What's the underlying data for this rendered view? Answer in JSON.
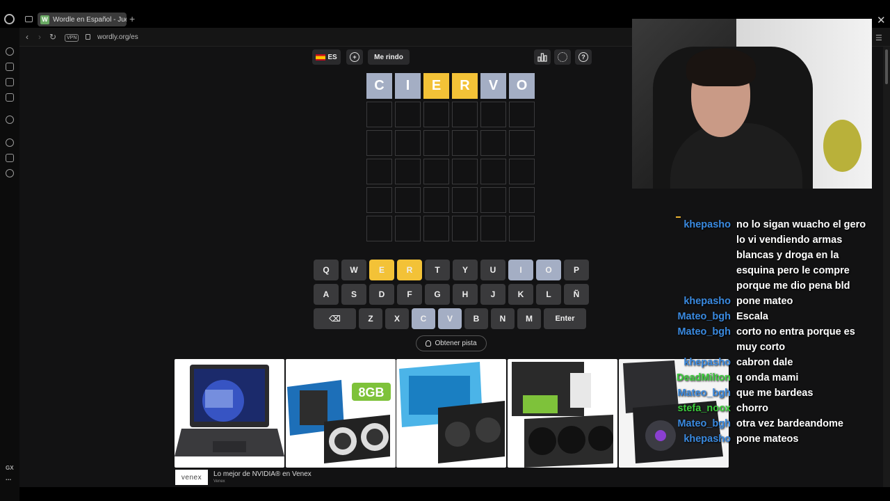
{
  "browser": {
    "tab_title": "Wordle en Español - Juego",
    "tab_favicon": "W",
    "url": "wordly.org/es",
    "vpn_label": "VPN",
    "sidebar_bottom_label": "GX"
  },
  "header": {
    "language": "ES",
    "give_up": "Me rindo",
    "icons": [
      "plus-circle-icon",
      "stats-icon",
      "settings-icon",
      "help-icon"
    ]
  },
  "board": {
    "rows": [
      [
        {
          "letter": "C",
          "state": "gray"
        },
        {
          "letter": "I",
          "state": "gray"
        },
        {
          "letter": "E",
          "state": "yellow"
        },
        {
          "letter": "R",
          "state": "yellow"
        },
        {
          "letter": "V",
          "state": "gray"
        },
        {
          "letter": "O",
          "state": "gray"
        }
      ],
      [
        {},
        {},
        {},
        {},
        {},
        {}
      ],
      [
        {},
        {},
        {},
        {},
        {},
        {}
      ],
      [
        {},
        {},
        {},
        {},
        {},
        {}
      ],
      [
        {},
        {},
        {},
        {},
        {},
        {}
      ],
      [
        {},
        {},
        {},
        {},
        {},
        {}
      ]
    ]
  },
  "keyboard": {
    "rows": [
      [
        {
          "k": "Q"
        },
        {
          "k": "W"
        },
        {
          "k": "E",
          "state": "yellow"
        },
        {
          "k": "R",
          "state": "yellow"
        },
        {
          "k": "T"
        },
        {
          "k": "Y"
        },
        {
          "k": "U"
        },
        {
          "k": "I",
          "state": "gray"
        },
        {
          "k": "O",
          "state": "gray"
        },
        {
          "k": "P"
        }
      ],
      [
        {
          "k": "A"
        },
        {
          "k": "S"
        },
        {
          "k": "D"
        },
        {
          "k": "F"
        },
        {
          "k": "G"
        },
        {
          "k": "H"
        },
        {
          "k": "J"
        },
        {
          "k": "K"
        },
        {
          "k": "L"
        },
        {
          "k": "Ñ"
        }
      ],
      [
        {
          "k": "⌫",
          "type": "backspace"
        },
        {
          "k": "Z"
        },
        {
          "k": "X"
        },
        {
          "k": "C",
          "state": "gray"
        },
        {
          "k": "V",
          "state": "gray"
        },
        {
          "k": "B"
        },
        {
          "k": "N"
        },
        {
          "k": "M"
        },
        {
          "k": "Enter",
          "type": "enter"
        }
      ]
    ]
  },
  "hint_button": "Obtener pista",
  "ad": {
    "products": [
      "laptop",
      "galax-rtx-5060ti-8gb",
      "gigabyte-rtx-5070",
      "asus-prime-rtx-5060ti",
      "gpu-dark"
    ],
    "card_texts": {
      "galax_badge": "8GB"
    },
    "brand": "venex",
    "title": "Lo mejor de NVIDIA® en Venex",
    "subtitle": "Venex"
  },
  "chat": [
    {
      "user": "khepasho",
      "color": "#3a8ae0",
      "text": "no lo sigan wuacho el gero lo vi vendiendo armas blancas y droga en la esquina pero le compre porque me dio pena bld"
    },
    {
      "user": "khepasho",
      "color": "#3a8ae0",
      "text": "pone mateo"
    },
    {
      "user": "Mateo_bgh",
      "color": "#3a8ae0",
      "text": "Escala"
    },
    {
      "user": "Mateo_bgh",
      "color": "#3a8ae0",
      "text": "corto no entra porque es muy corto"
    },
    {
      "user": "khepasho",
      "color": "#3a8ae0",
      "text": "cabron dale"
    },
    {
      "user": "DeadMilton",
      "color": "#3dce3d",
      "text": "q onda mami"
    },
    {
      "user": "Mateo_bgh",
      "color": "#3a8ae0",
      "text": "que me bardeas"
    },
    {
      "user": "stefa_noox",
      "color": "#3dce3d",
      "text": "chorro"
    },
    {
      "user": "Mateo_bgh",
      "color": "#3a8ae0",
      "text": "otra vez bardeandome"
    },
    {
      "user": "khepasho",
      "color": "#3a8ae0",
      "text": "pone mateos"
    }
  ]
}
